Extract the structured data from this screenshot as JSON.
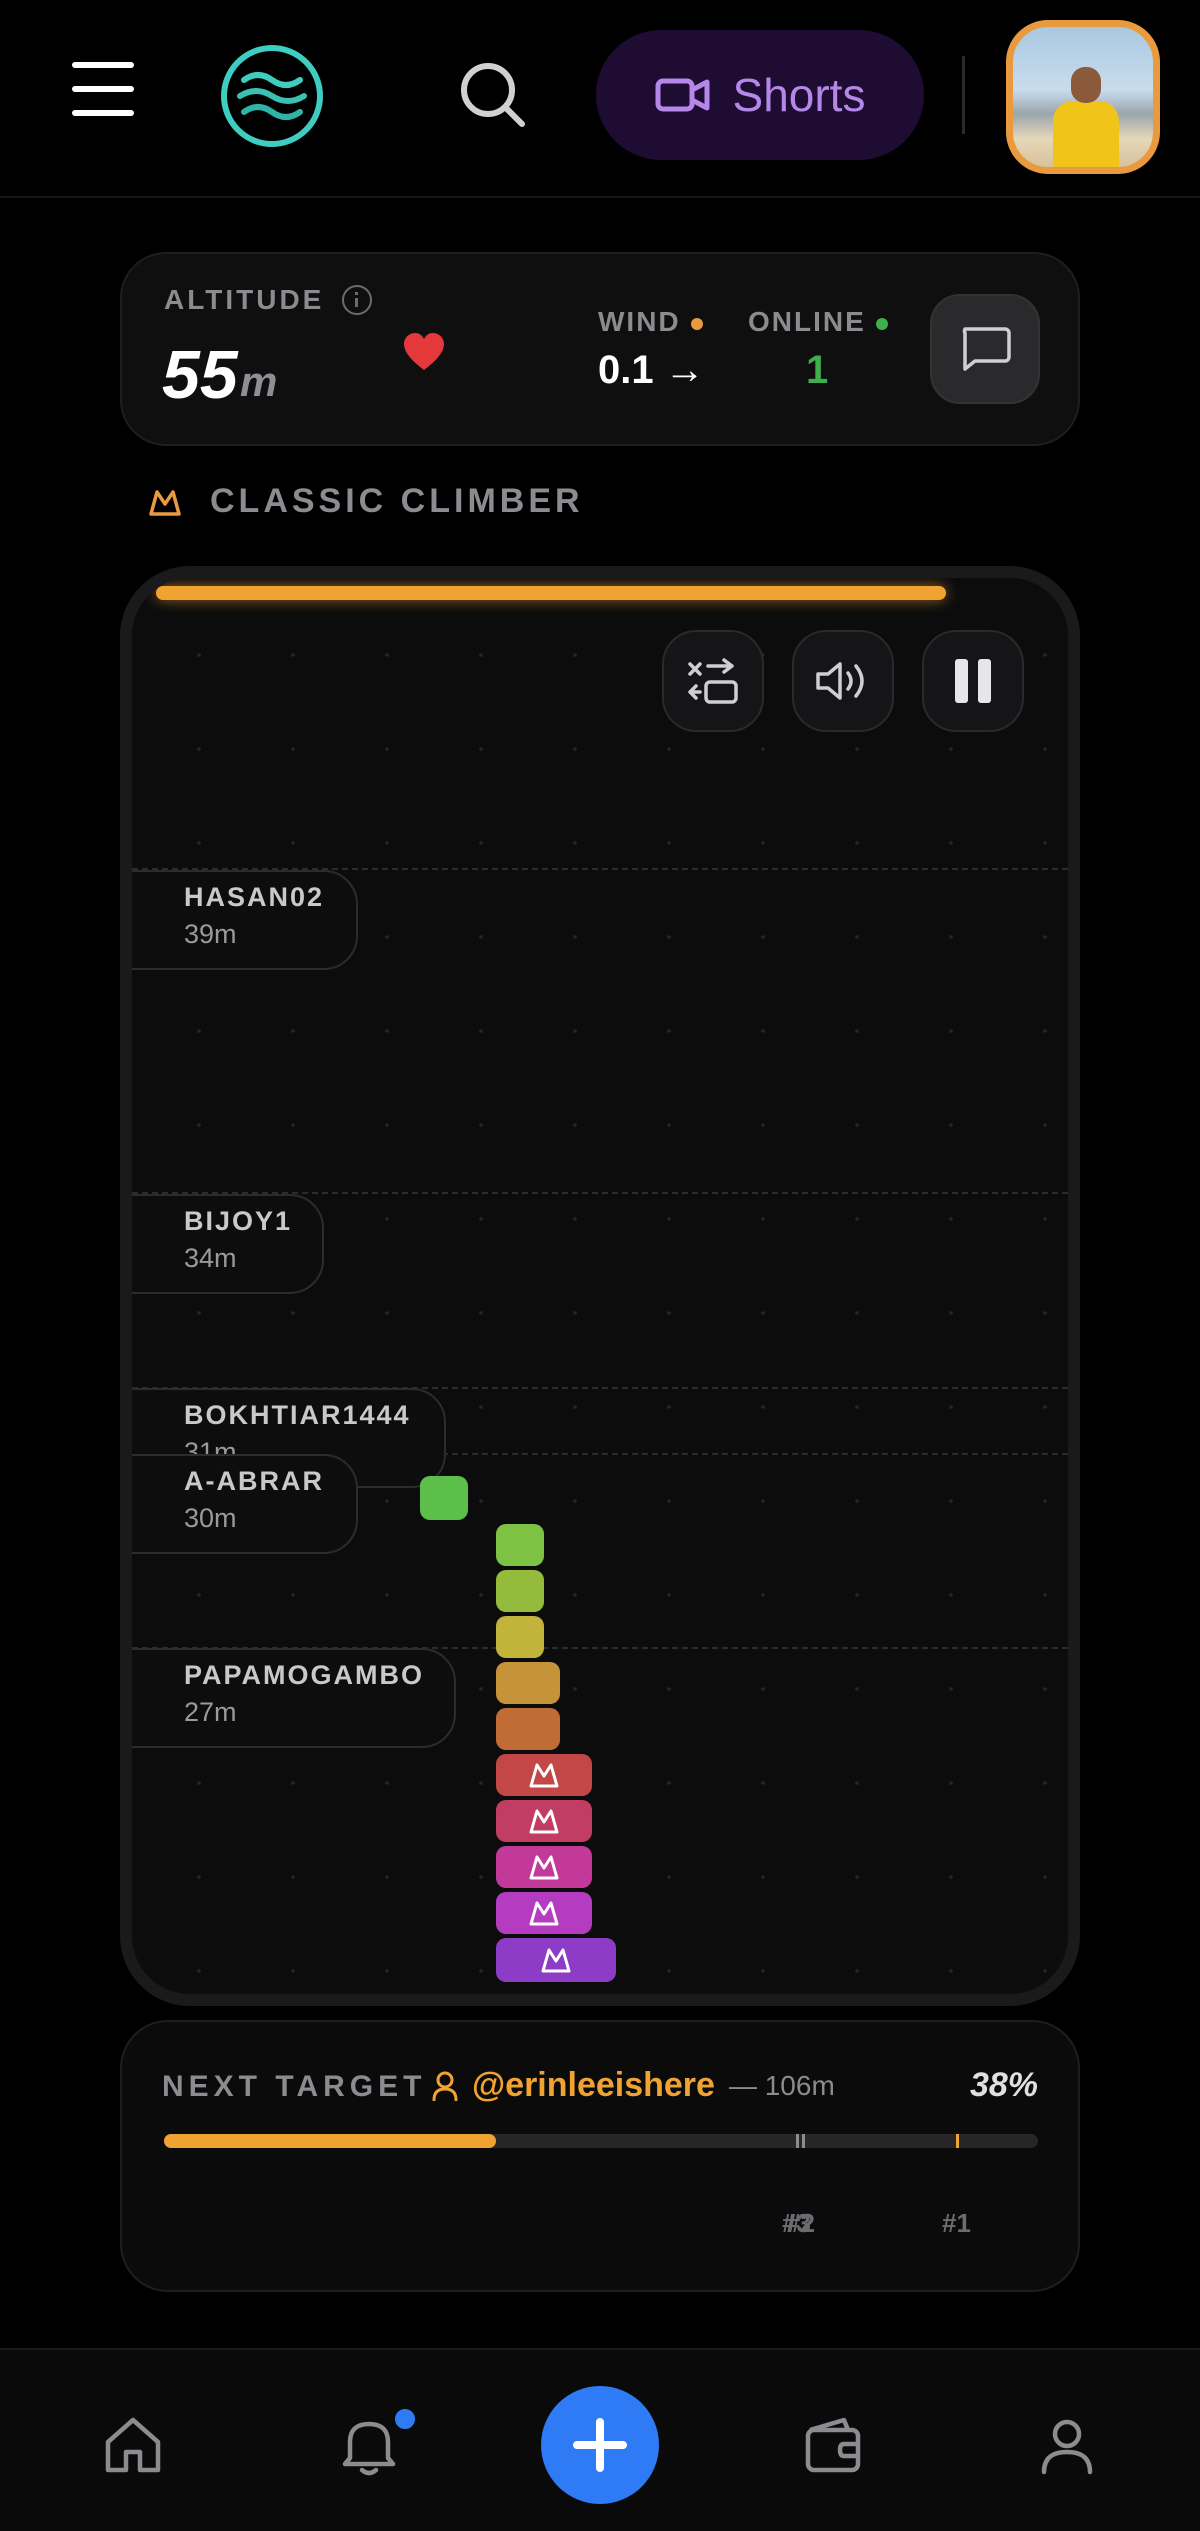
{
  "header": {
    "shorts_label": "Shorts"
  },
  "stats": {
    "altitude_label": "ALTITUDE",
    "altitude_value": "55",
    "altitude_unit": "m",
    "wind_label": "WIND",
    "wind_value": "0.1 →",
    "online_label": "ONLINE",
    "online_value": "1",
    "colors": {
      "wind_dot": "#e99a3e",
      "online_dot": "#3fae4c",
      "heart": "#e5383b"
    }
  },
  "mode": {
    "label": "CLASSIC CLIMBER"
  },
  "game": {
    "progress_fraction": 0.85,
    "controls": [
      "swap-icon",
      "volume-icon",
      "pause-icon"
    ],
    "players": [
      {
        "name": "HASAN02",
        "height": "39m"
      },
      {
        "name": "BIJOY1",
        "height": "34m"
      },
      {
        "name": "BOKHTIAR1444",
        "height": "31m"
      },
      {
        "name": "A-ABRAR",
        "height": "30m"
      },
      {
        "name": "PAPAMOGAMBO",
        "height": "27m"
      }
    ],
    "block_colors": [
      "#5cbf4a",
      "#7ec243",
      "#94bb3b",
      "#c2b33b",
      "#c59438",
      "#bf6c36",
      "#c24746",
      "#c23d63",
      "#c2399a",
      "#b53cc0",
      "#8d3cc8"
    ]
  },
  "target": {
    "label": "NEXT TARGET",
    "handle": "@erinleeishere",
    "distance": "— 106m",
    "percent": "38%",
    "progress_fraction": 0.38,
    "rank_2": "#2",
    "rank_3": "#3",
    "rank_1": "#1"
  },
  "nav": {
    "items": [
      "home-icon",
      "bell-icon",
      "add-icon",
      "wallet-icon",
      "profile-icon"
    ],
    "accent": "#2f7af5"
  }
}
